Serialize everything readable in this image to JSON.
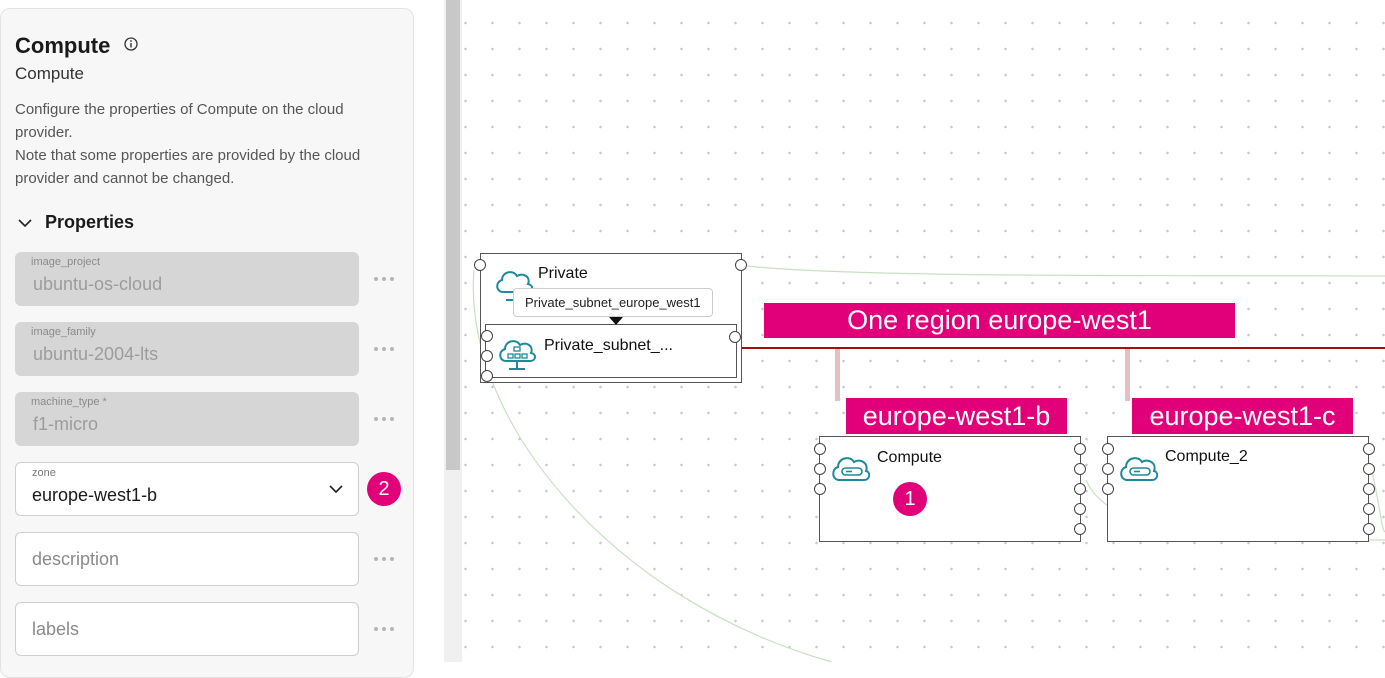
{
  "panel": {
    "title": "Compute",
    "subtitle": "Compute",
    "description_line1": "Configure the properties of Compute on the cloud provider.",
    "description_line2": "Note that some properties are provided by the cloud provider and cannot be changed.",
    "section_title": "Properties",
    "fields": {
      "image_project": {
        "label": "image_project",
        "value": "ubuntu-os-cloud"
      },
      "image_family": {
        "label": "image_family",
        "value": "ubuntu-2004-lts"
      },
      "machine_type": {
        "label": "machine_type *",
        "value": "f1-micro"
      },
      "zone": {
        "label": "zone",
        "value": "europe-west1-b"
      },
      "description": {
        "placeholder": "description"
      },
      "labels": {
        "placeholder": "labels"
      }
    },
    "callout_2": "2"
  },
  "canvas": {
    "private_network": {
      "label": "Private"
    },
    "subnet": {
      "label": "Private_subnet_...",
      "tooltip": "Private_subnet_europe_west1"
    },
    "region_tag": "One region europe-west1",
    "zone_tag_b": "europe-west1-b",
    "zone_tag_c": "europe-west1-c",
    "compute": {
      "label": "Compute"
    },
    "compute_2": {
      "label": "Compute_2"
    },
    "callout_1": "1"
  },
  "colors": {
    "accent_magenta": "#e2007a",
    "network_line": "#a50f0f",
    "teal_icon": "#1c8a9a",
    "connector_green": "#b9d9b3"
  },
  "icons": [
    "info-icon",
    "chevron-down-icon",
    "more-options-icon",
    "cloud-network-icon",
    "subnet-icon",
    "compute-instance-icon"
  ]
}
